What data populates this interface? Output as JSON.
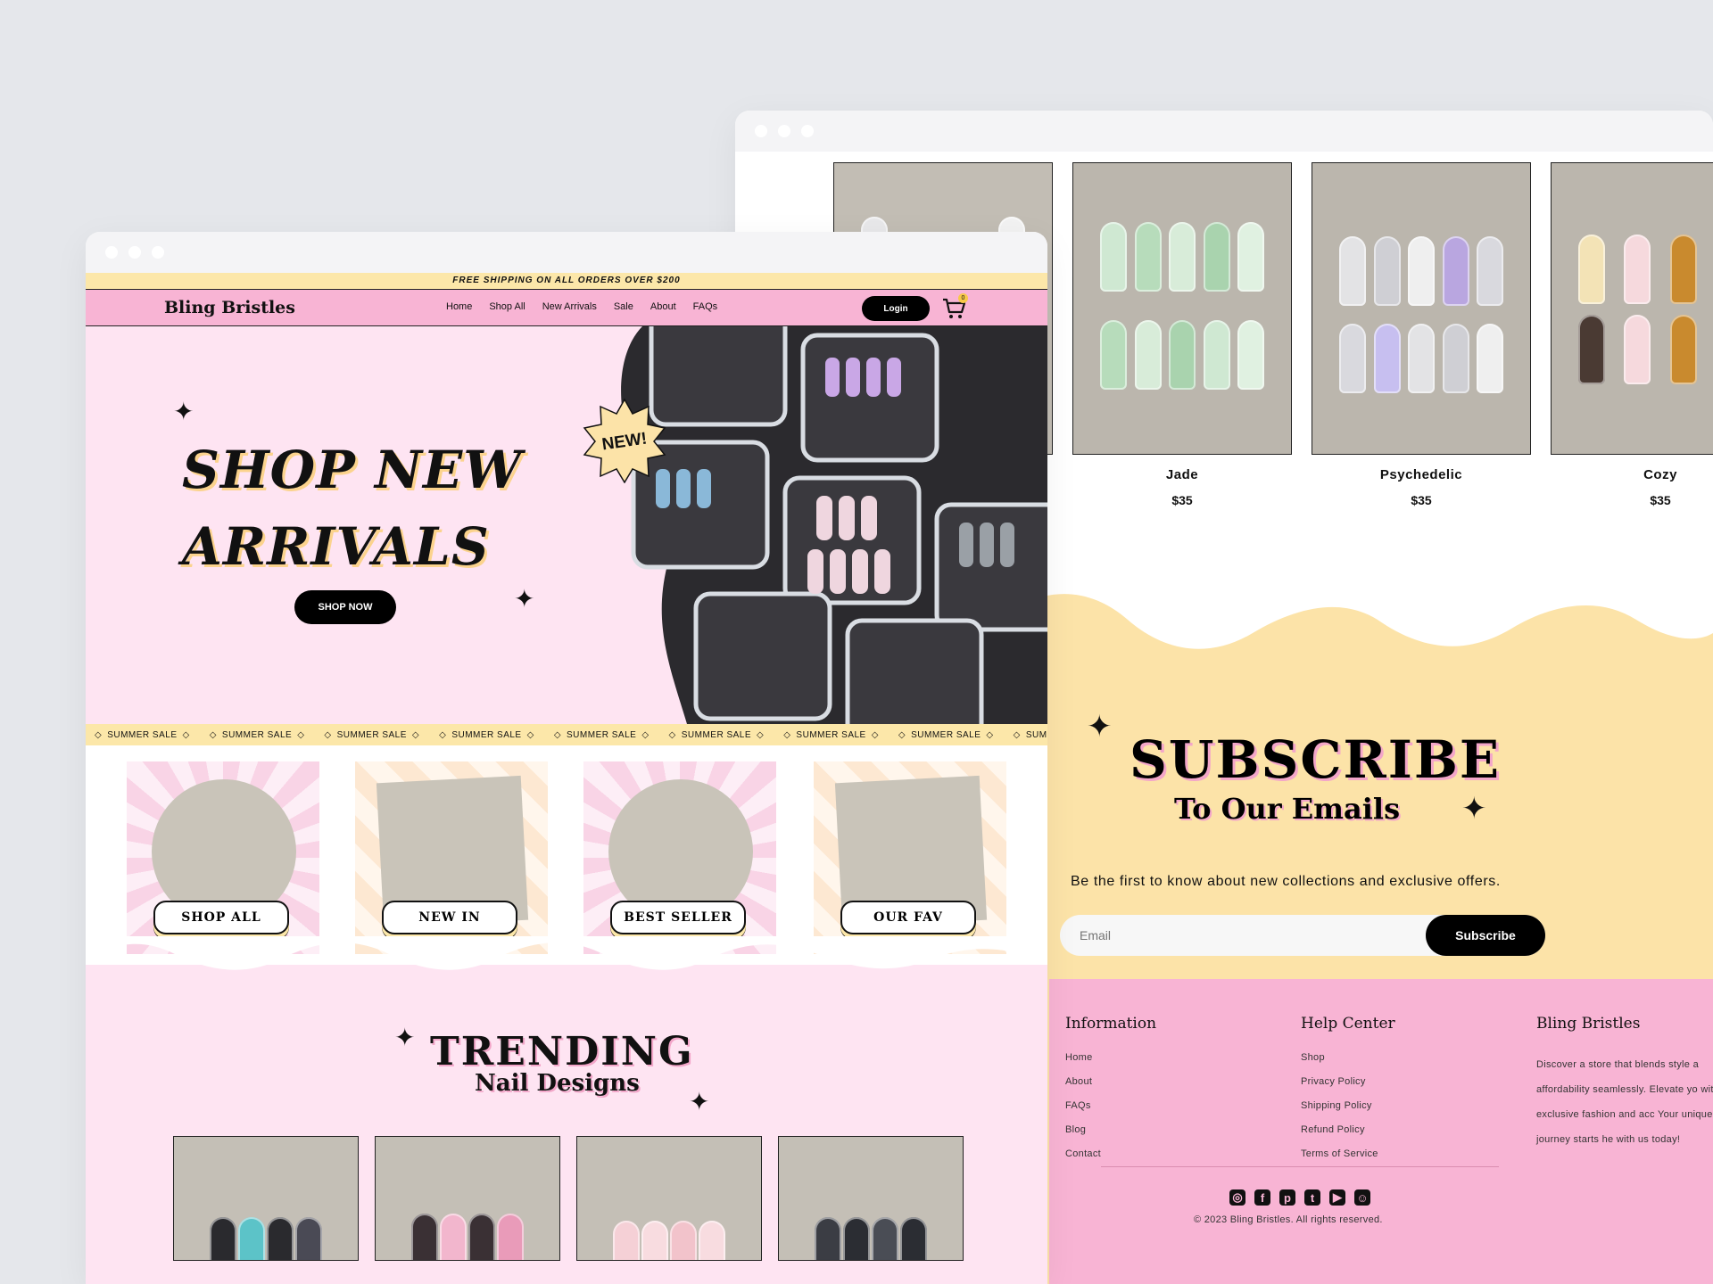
{
  "back_window": {
    "products": [
      {
        "name": "",
        "price": ""
      },
      {
        "name": "Jade",
        "price": "$35"
      },
      {
        "name": "Psychedelic",
        "price": "$35"
      },
      {
        "name": "Cozy",
        "price": "$35"
      }
    ],
    "subscribe": {
      "title": "SUBSCRIBE",
      "subtitle": "To Our Emails",
      "description": "Be the first to know about new collections and exclusive offers.",
      "email_placeholder": "Email",
      "button": "Subscribe"
    },
    "footer": {
      "info_heading": "Information",
      "info_links": [
        "Home",
        "About",
        "FAQs",
        "Blog",
        "Contact"
      ],
      "help_heading": "Help Center",
      "help_links": [
        "Shop",
        "Privacy Policy",
        "Shipping Policy",
        "Refund Policy",
        "Terms of Service"
      ],
      "brand_heading": "Bling Bristles",
      "brand_desc": "Discover a store that blends style a affordability seamlessly. Elevate yo with our exclusive fashion and acc Your unique style journey starts he with us today!",
      "social_icons": [
        "instagram-icon",
        "facebook-icon",
        "pinterest-icon",
        "twitter-icon",
        "youtube-icon",
        "discord-icon"
      ],
      "copyright": "© 2023 Bling Bristles. All rights reserved."
    }
  },
  "front_window": {
    "shipping_banner": "FREE SHIPPING ON ALL ORDERS OVER $200",
    "logo": "Bling Bristles",
    "nav": [
      "Home",
      "Shop All",
      "New Arrivals",
      "Sale",
      "About",
      "FAQs"
    ],
    "login": "Login",
    "cart_count": "0",
    "hero": {
      "title": "SHOP NEW ARRIVALS",
      "badge": "NEW!",
      "button": "SHOP NOW"
    },
    "ticker_text": "SUMMER SALE",
    "ticker_count": 9,
    "categories": [
      "SHOP ALL",
      "NEW IN",
      "BEST SELLER",
      "OUR FAV"
    ],
    "trending": {
      "title": "TRENDING",
      "subtitle": "Nail Designs"
    }
  },
  "colors": {
    "pink": "#f8b4d4",
    "light_pink": "#fee4f2",
    "cream": "#fce7a9",
    "black": "#000000"
  }
}
